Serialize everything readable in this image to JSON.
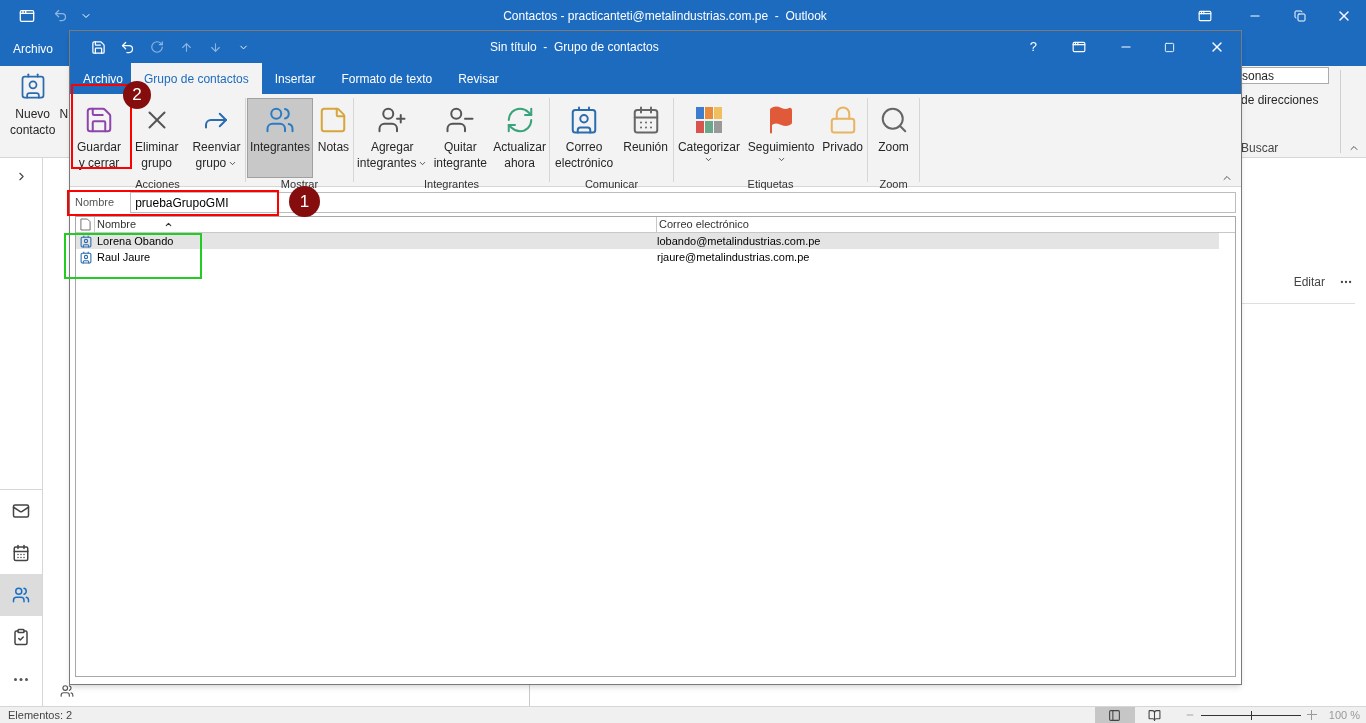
{
  "outlook": {
    "title": "Contactos - practicanteti@metalindustrias.com.pe  -  Outlook",
    "tabs": [
      {
        "label": "Archivo"
      }
    ],
    "ribbon_buttons": [
      {
        "lines": [
          "Nuevo",
          "contacto"
        ]
      },
      {
        "lines": [
          "N"
        ]
      }
    ],
    "search_field": {
      "value": "sonas"
    },
    "address_book": "de direcciones",
    "search_group": "Buscar",
    "nav": [
      {
        "kind": "mail",
        "selected": false
      },
      {
        "kind": "calendar",
        "selected": false
      },
      {
        "kind": "people",
        "selected": true
      },
      {
        "kind": "tasks",
        "selected": false
      },
      {
        "kind": "more",
        "selected": false
      }
    ],
    "edit_link": "Editar",
    "status_bar": {
      "items": "Elementos: 2",
      "views": [
        {
          "kind": "normal",
          "selected": true
        },
        {
          "kind": "reading",
          "selected": false
        }
      ],
      "zoom": {
        "level": 0.5,
        "reading": "100 %"
      }
    }
  },
  "dialog": {
    "title": "Sin título  -  Grupo de contactos",
    "help": "?",
    "tabs": [
      {
        "label": "Archivo",
        "selected": false
      },
      {
        "label": "Grupo de contactos",
        "selected": true
      },
      {
        "label": "Insertar",
        "selected": false
      },
      {
        "label": "Formato de texto",
        "selected": false
      },
      {
        "label": "Revisar",
        "selected": false
      }
    ],
    "groups": [
      {
        "label": "Acciones",
        "buttons": [
          {
            "kind": "save",
            "lines": [
              "Guardar",
              "y cerrar"
            ],
            "dropdown": false,
            "selected": false
          },
          {
            "kind": "delete",
            "lines": [
              "Eliminar",
              "grupo"
            ],
            "dropdown": false,
            "selected": false
          },
          {
            "kind": "forward",
            "lines": [
              "Reenviar",
              "grupo"
            ],
            "dropdown": true,
            "selected": false
          }
        ]
      },
      {
        "label": "Mostrar",
        "buttons": [
          {
            "kind": "members",
            "lines": [
              "Integrantes"
            ],
            "dropdown": false,
            "selected": true
          },
          {
            "kind": "notes",
            "lines": [
              "Notas"
            ],
            "dropdown": false,
            "selected": false
          }
        ]
      },
      {
        "label": "Integrantes",
        "buttons": [
          {
            "kind": "add",
            "lines": [
              "Agregar",
              "integrantes"
            ],
            "dropdown": true,
            "selected": false
          },
          {
            "kind": "remove",
            "lines": [
              "Quitar",
              "integrante"
            ],
            "dropdown": false,
            "selected": false
          },
          {
            "kind": "refresh",
            "lines": [
              "Actualizar",
              "ahora"
            ],
            "dropdown": false,
            "selected": false
          }
        ]
      },
      {
        "label": "Comunicar",
        "buttons": [
          {
            "kind": "email",
            "lines": [
              "Correo",
              "electrónico"
            ],
            "dropdown": false,
            "selected": false
          },
          {
            "kind": "meeting",
            "lines": [
              "Reunión"
            ],
            "dropdown": false,
            "selected": false
          }
        ]
      },
      {
        "label": "Etiquetas",
        "buttons": [
          {
            "kind": "categorize",
            "lines": [
              "Categorizar"
            ],
            "dropdown": true,
            "selected": false
          },
          {
            "kind": "flag",
            "lines": [
              "Seguimiento"
            ],
            "dropdown": true,
            "selected": false
          },
          {
            "kind": "lock",
            "lines": [
              "Privado"
            ],
            "dropdown": false,
            "selected": false
          }
        ]
      },
      {
        "label": "Zoom",
        "buttons": [
          {
            "kind": "zoom",
            "lines": [
              "Zoom"
            ],
            "dropdown": false,
            "selected": false
          }
        ]
      }
    ],
    "name_field": {
      "label": "Nombre",
      "value": "pruebaGrupoGMI"
    },
    "columns": [
      {
        "label": "Nombre",
        "sorted": true
      },
      {
        "label": "Correo electrónico",
        "sorted": false
      }
    ],
    "rows": [
      {
        "name": "Lorena Obando",
        "email": "lobando@metalindustrias.com.pe",
        "selected": true
      },
      {
        "name": "Raul Jaure",
        "email": "rjaure@metalindustrias.com.pe",
        "selected": false
      }
    ]
  },
  "annotations": {
    "boxes": [
      {
        "color": "#ff0000"
      },
      {
        "color": "#ff0000"
      },
      {
        "color": "#22cc22"
      }
    ],
    "badges": [
      {
        "label": "1"
      },
      {
        "label": "2"
      }
    ]
  }
}
